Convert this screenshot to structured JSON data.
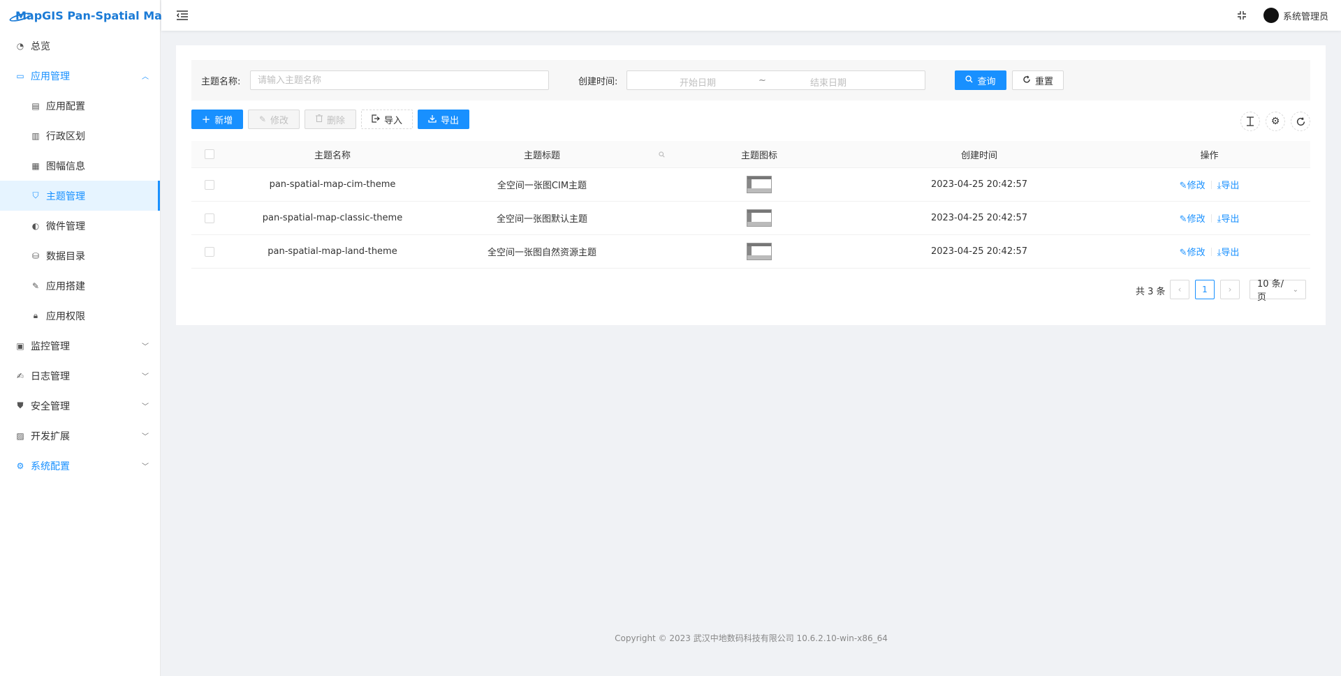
{
  "app": {
    "title": "MapGIS Pan-Spatial Map"
  },
  "sidebar": {
    "items": [
      {
        "label": "总览",
        "icon": "dashboard-icon",
        "level": 1
      },
      {
        "label": "应用管理",
        "icon": "desktop-icon",
        "level": 1,
        "expanded": true
      },
      {
        "label": "应用配置",
        "icon": "app-config-icon",
        "level": 2
      },
      {
        "label": "行政区划",
        "icon": "region-icon",
        "level": 2
      },
      {
        "label": "图幅信息",
        "icon": "grid-icon",
        "level": 2
      },
      {
        "label": "主题管理",
        "icon": "shirt-icon",
        "level": 2,
        "active": true
      },
      {
        "label": "微件管理",
        "icon": "widget-icon",
        "level": 2
      },
      {
        "label": "数据目录",
        "icon": "catalog-icon",
        "level": 2
      },
      {
        "label": "应用搭建",
        "icon": "edit-icon",
        "level": 2
      },
      {
        "label": "应用权限",
        "icon": "lock-icon",
        "level": 2
      },
      {
        "label": "监控管理",
        "icon": "monitor-icon",
        "level": 1
      },
      {
        "label": "日志管理",
        "icon": "log-icon",
        "level": 1
      },
      {
        "label": "安全管理",
        "icon": "shield-icon",
        "level": 1
      },
      {
        "label": "开发扩展",
        "icon": "toolbox-icon",
        "level": 1
      },
      {
        "label": "系统配置",
        "icon": "gear-icon",
        "level": 1,
        "highlight": true
      }
    ]
  },
  "header": {
    "username": "系统管理员"
  },
  "search": {
    "name_label": "主题名称:",
    "name_placeholder": "请输入主题名称",
    "time_label": "创建时间:",
    "start_placeholder": "开始日期",
    "date_separator": "~",
    "end_placeholder": "结束日期",
    "query_label": "查询",
    "reset_label": "重置"
  },
  "toolbar": {
    "add_label": "新增",
    "edit_label": "修改",
    "delete_label": "删除",
    "import_label": "导入",
    "export_label": "导出"
  },
  "table": {
    "columns": [
      "主题名称",
      "主题标题",
      "主题图标",
      "创建时间",
      "操作"
    ],
    "rows": [
      {
        "name": "pan-spatial-map-cim-theme",
        "title": "全空间一张图CIM主题",
        "created": "2023-04-25 20:42:57",
        "edit": "修改",
        "export": "导出"
      },
      {
        "name": "pan-spatial-map-classic-theme",
        "title": "全空间一张图默认主题",
        "created": "2023-04-25 20:42:57",
        "edit": "修改",
        "export": "导出"
      },
      {
        "name": "pan-spatial-map-land-theme",
        "title": "全空间一张图自然资源主题",
        "created": "2023-04-25 20:42:57",
        "edit": "修改",
        "export": "导出"
      }
    ]
  },
  "pagination": {
    "total": "共 3 条",
    "current": "1",
    "page_size": "10 条/页"
  },
  "footer": {
    "copyright": "Copyright © 2023 武汉中地数码科技有限公司 10.6.2.10-win-x86_64"
  },
  "colors": {
    "accent": "#1890ff",
    "active_bg": "#e6f4ff",
    "page_bg": "#f0f2f5"
  }
}
